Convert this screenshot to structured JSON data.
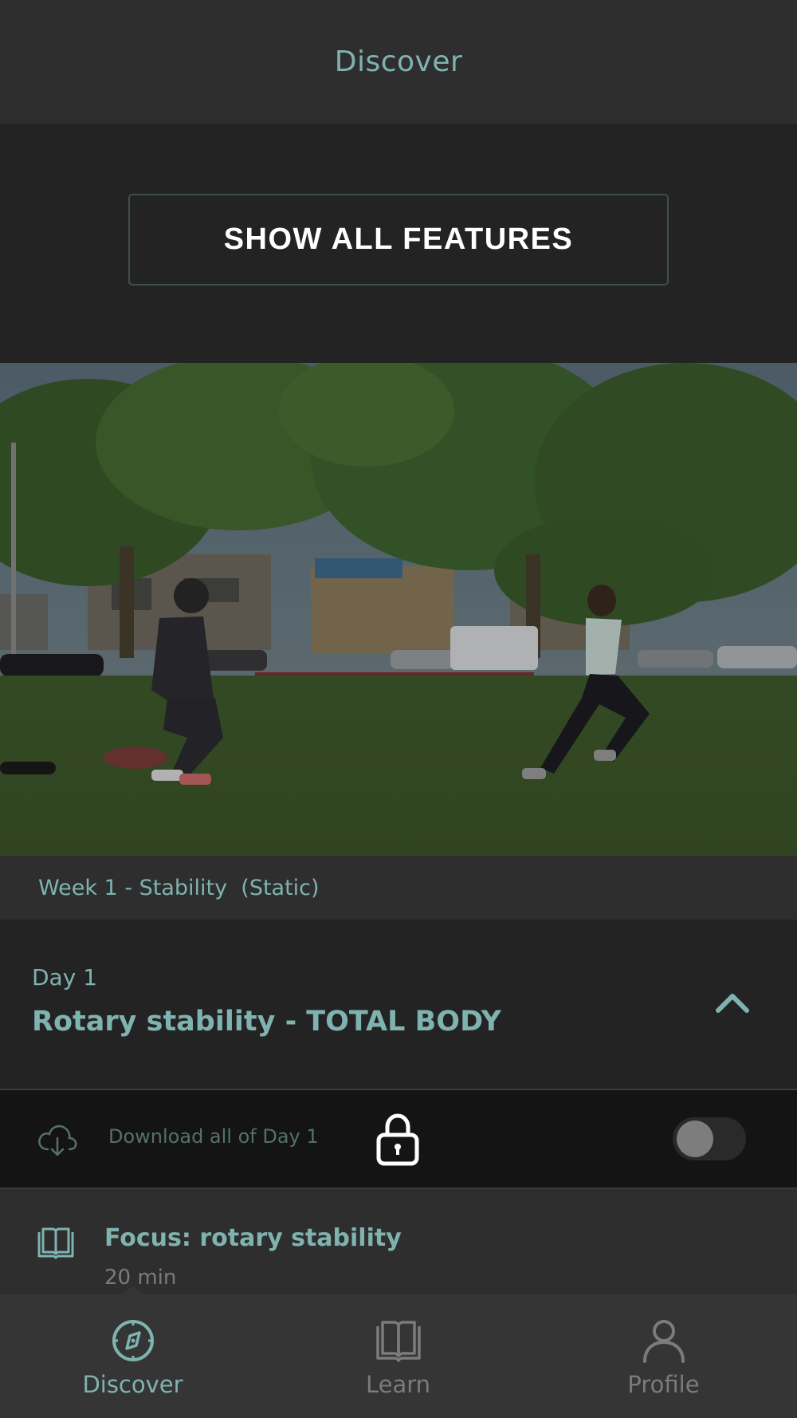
{
  "header": {
    "title": "Discover"
  },
  "features": {
    "button_label": "SHOW ALL FEATURES"
  },
  "hero": {
    "image_alt_icon": "hero-photo"
  },
  "week": {
    "label": "Week 1 - Stability  (Static)"
  },
  "day": {
    "small_label": "Day 1",
    "title": "Rotary stability - TOTAL BODY",
    "collapse_icon": "chevron-up-icon"
  },
  "download": {
    "label": "Download all of Day 1",
    "toggle_on": false,
    "icons": [
      "cloud-download-icon",
      "lock-icon"
    ]
  },
  "focus": {
    "title": "Focus: rotary stability",
    "duration": "20 min",
    "icon": "book-icon"
  },
  "tabbar": {
    "active": "discover",
    "tabs": [
      {
        "id": "discover",
        "label": "Discover",
        "icon": "compass-icon"
      },
      {
        "id": "learn",
        "label": "Learn",
        "icon": "book-icon"
      },
      {
        "id": "profile",
        "label": "Profile",
        "icon": "person-icon"
      }
    ]
  },
  "colors": {
    "accent": "#7fb3b0",
    "background": "#232323",
    "bar": "#2e2e2e",
    "inactive": "#7b7b7b"
  }
}
